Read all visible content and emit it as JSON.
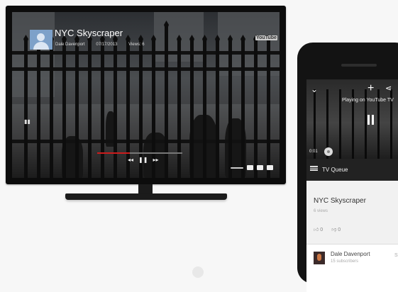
{
  "tv": {
    "video_title": "NYC Skyscraper",
    "channel": "Dale Davenport",
    "date": "07/17/2013",
    "views": "Views: 6",
    "watermark": "YouTube",
    "progress_fraction": 0.38
  },
  "phone": {
    "playing_text": "Playing on YouTube TV",
    "time": "0:01",
    "queue_label": "TV Queue",
    "video_title": "NYC Skyscraper",
    "views": "6 views",
    "likes": "0",
    "dislikes": "0",
    "channel_name": "Dale Davenport",
    "channel_subs": "15 subscribers",
    "channel_more": "S"
  },
  "icons": {
    "tv_avatar": "user-avatar-icon",
    "phone_collapse": "chevron-down-icon",
    "phone_add": "plus-icon",
    "phone_share": "share-icon",
    "phone_pause": "pause-icon",
    "queue_menu": "menu-icon",
    "like": "thumbs-up-icon",
    "dislike": "thumbs-down-icon"
  },
  "colors": {
    "progress": "#cc1c1c",
    "queue_bar": "#222222"
  }
}
